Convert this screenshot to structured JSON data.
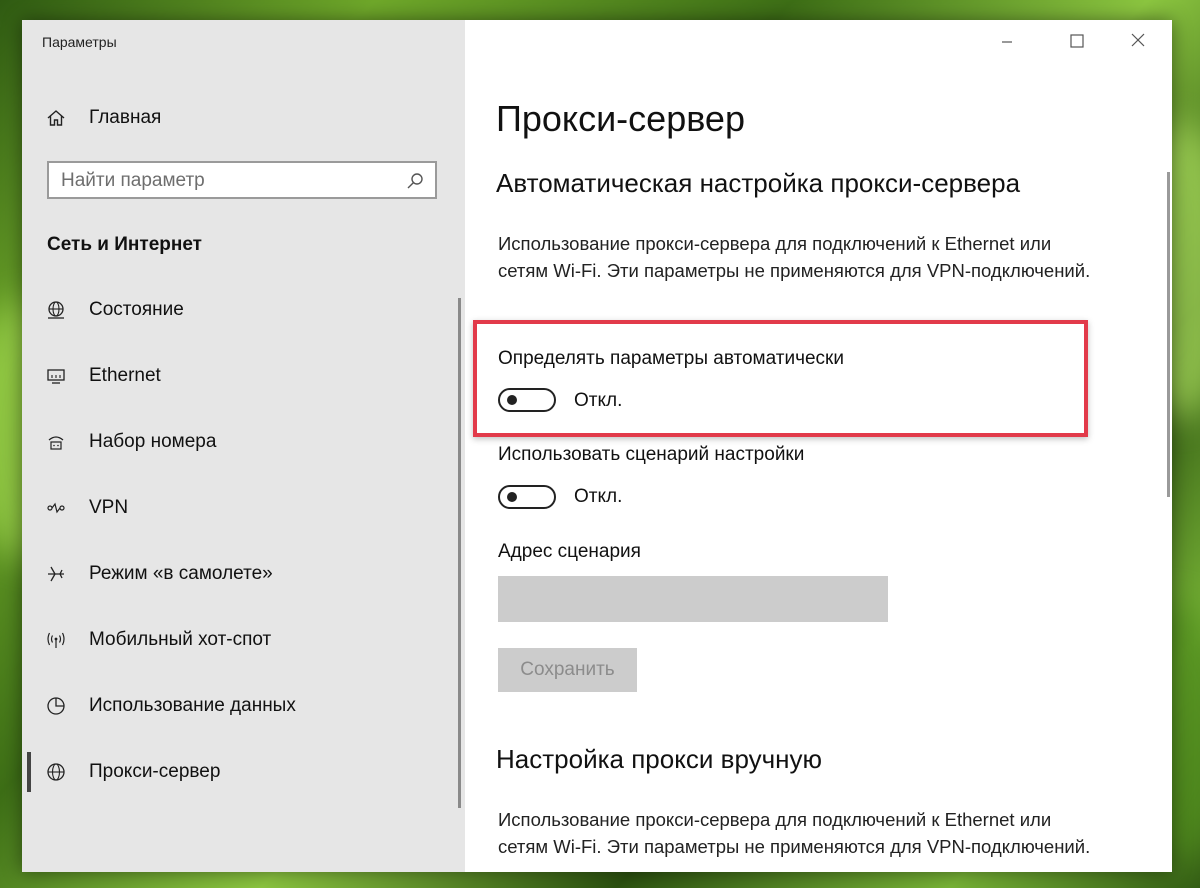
{
  "window": {
    "title": "Параметры",
    "controls": [
      "minimize-icon",
      "maximize-icon",
      "close-icon"
    ]
  },
  "sidebar": {
    "home_label": "Главная",
    "search_placeholder": "Найти параметр",
    "section_title": "Сеть и Интернет",
    "items": [
      {
        "label": "Состояние",
        "icon": "globe-status-icon"
      },
      {
        "label": "Ethernet",
        "icon": "ethernet-icon"
      },
      {
        "label": "Набор номера",
        "icon": "dialup-icon"
      },
      {
        "label": "VPN",
        "icon": "vpn-icon"
      },
      {
        "label": "Режим «в самолете»",
        "icon": "airplane-icon"
      },
      {
        "label": "Мобильный хот-спот",
        "icon": "hotspot-icon"
      },
      {
        "label": "Использование данных",
        "icon": "data-usage-icon"
      },
      {
        "label": "Прокси-сервер",
        "icon": "globe-icon",
        "active": true
      }
    ]
  },
  "main": {
    "page_title": "Прокси-сервер",
    "auto_section": {
      "heading": "Автоматическая настройка прокси-сервера",
      "description": "Использование прокси-сервера для подключений к Ethernet или сетям Wi-Fi. Эти параметры не применяются для VPN-подключений.",
      "detect_label": "Определять параметры автоматически",
      "detect_state": "Откл.",
      "script_label": "Использовать сценарий настройки",
      "script_state": "Откл.",
      "address_label": "Адрес сценария",
      "address_value": "",
      "save_label": "Сохранить"
    },
    "manual_section": {
      "heading": "Настройка прокси вручную",
      "description": "Использование прокси-сервера для подключений к Ethernet или сетям Wi-Fi. Эти параметры не применяются для VPN-подключений."
    }
  },
  "colors": {
    "sidebar_bg": "#e6e6e6",
    "highlight": "#e23a4a",
    "disabled_fill": "#cccccc"
  }
}
